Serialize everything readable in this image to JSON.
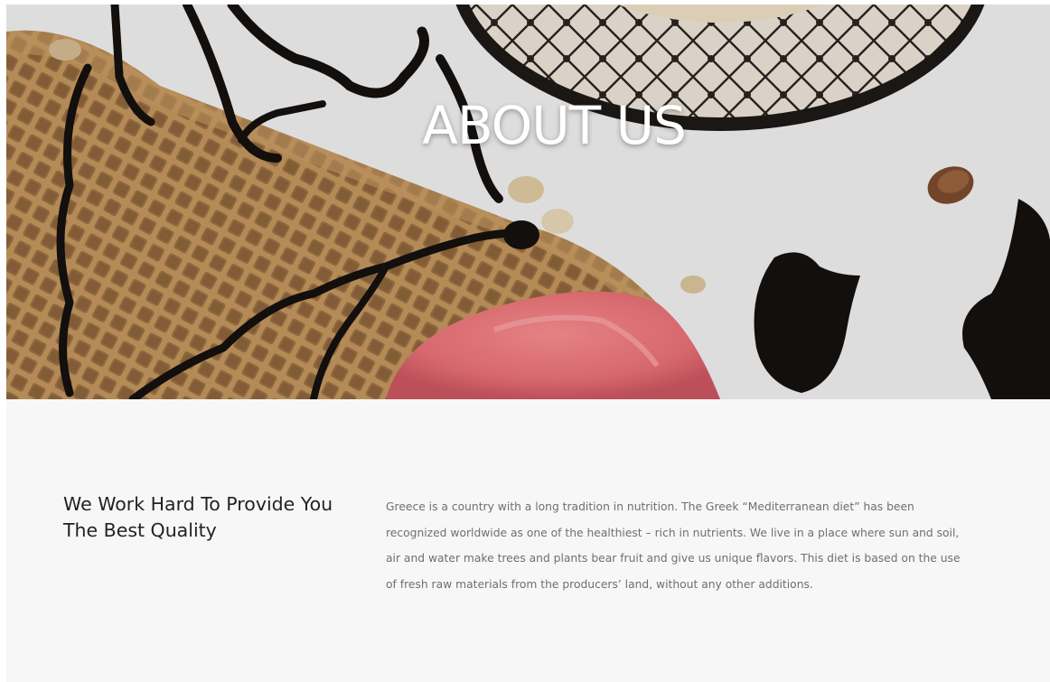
{
  "hero": {
    "title": "ABOUT US",
    "image": "ice-cream-cone-with-chocolate-drizzle"
  },
  "about": {
    "heading": "We Work Hard To Provide You The Best Quality",
    "body": "Greece is a country with a long tradition in nutrition. The Greek “Mediterranean diet” has been recognized worldwide as one of the healthiest – rich in nutrients. We live in a place where sun and soil, air and water make trees and plants bear fruit and give us unique flavors. This diet is based on the use of fresh raw materials from the producers’ land, without any other additions."
  },
  "colors": {
    "section_background": "#f7f7f7",
    "heading_text": "#222222",
    "body_text": "#6f6f6f",
    "hero_title": "#ffffff"
  }
}
